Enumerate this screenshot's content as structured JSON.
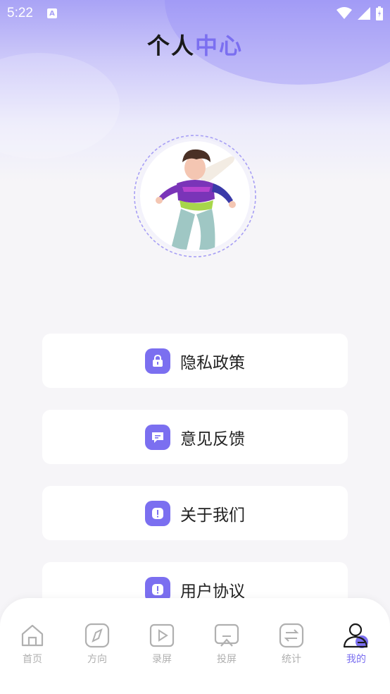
{
  "status_bar": {
    "time": "5:22",
    "notification_letter": "A"
  },
  "header": {
    "title_part1": "个人",
    "title_part2": "中心"
  },
  "menu": [
    {
      "label": "隐私政策",
      "icon": "lock-icon"
    },
    {
      "label": "意见反馈",
      "icon": "chat-icon"
    },
    {
      "label": "关于我们",
      "icon": "info-icon"
    },
    {
      "label": "用户协议",
      "icon": "info-icon"
    }
  ],
  "tabs": [
    {
      "label": "首页",
      "icon": "home-icon",
      "active": false
    },
    {
      "label": "方向",
      "icon": "compass-icon",
      "active": false
    },
    {
      "label": "录屏",
      "icon": "video-icon",
      "active": false
    },
    {
      "label": "投屏",
      "icon": "cast-icon",
      "active": false
    },
    {
      "label": "统计",
      "icon": "switch-icon",
      "active": false
    },
    {
      "label": "我的",
      "icon": "user-icon",
      "active": true
    }
  ],
  "colors": {
    "accent": "#7b6ff0",
    "inactive": "#b0b0b0",
    "header_gradient": "#a9a3f6"
  }
}
